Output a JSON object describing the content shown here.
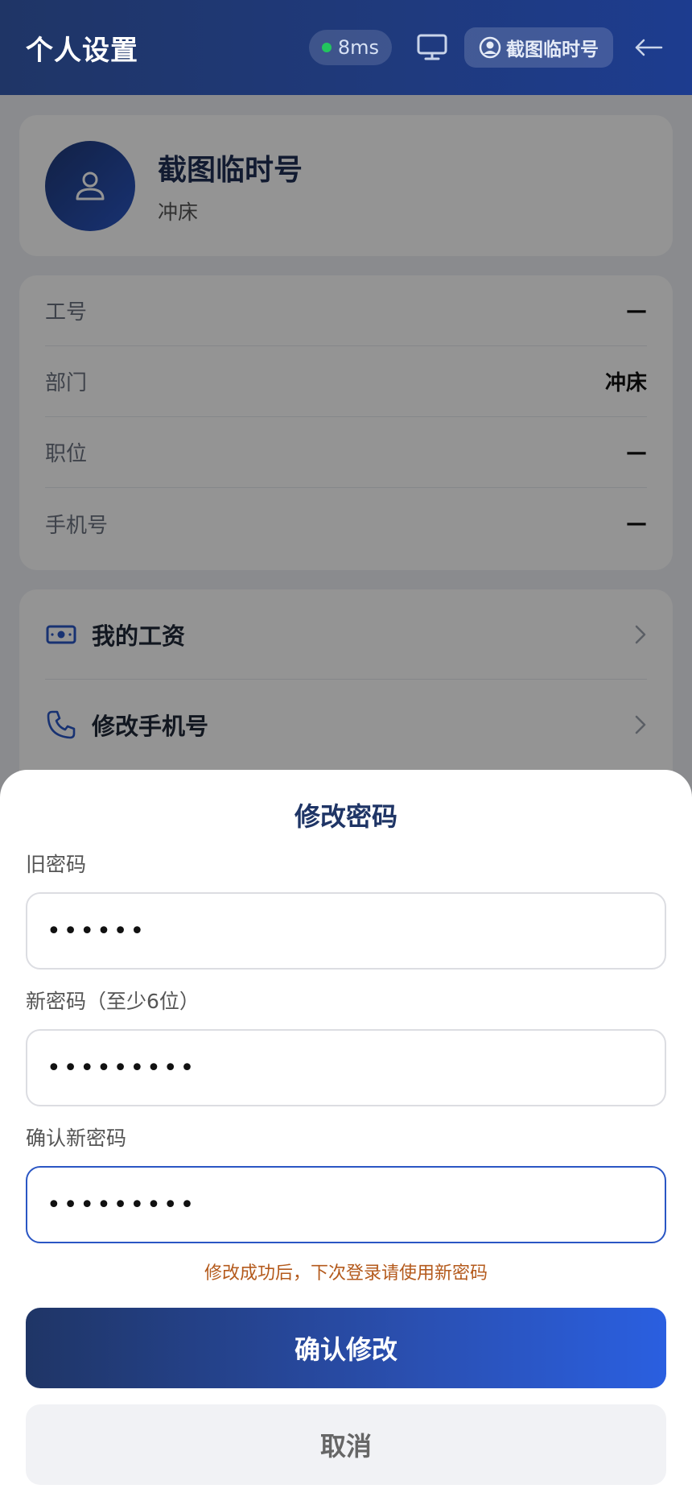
{
  "header": {
    "title": "个人设置",
    "latency": "8ms",
    "user": "截图临时号",
    "icons": [
      "monitor-icon",
      "user-circle-icon",
      "arrow-left-icon"
    ]
  },
  "profile": {
    "name": "截图临时号",
    "department": "冲床",
    "avatar_icon": "user-icon"
  },
  "info": {
    "rows": [
      {
        "label": "工号",
        "value": "—"
      },
      {
        "label": "部门",
        "value": "冲床"
      },
      {
        "label": "职位",
        "value": "—"
      },
      {
        "label": "手机号",
        "value": "—"
      }
    ]
  },
  "menu": {
    "items": [
      {
        "label": "我的工资",
        "icon": "cash-icon"
      },
      {
        "label": "修改手机号",
        "icon": "phone-icon"
      }
    ]
  },
  "sheet": {
    "title": "修改密码",
    "old_password_label": "旧密码",
    "old_password_value": "••••••",
    "new_password_label": "新密码（至少6位）",
    "new_password_value": "•••••••••",
    "confirm_password_label": "确认新密码",
    "confirm_password_value": "•••••••••",
    "hint": "修改成功后，下次登录请使用新密码",
    "confirm_label": "确认修改",
    "cancel_label": "取消"
  },
  "colors": {
    "brand": "#1f3566",
    "accent": "#2a56c4",
    "status_ok": "#22c55e",
    "hint": "#b45a1c"
  }
}
